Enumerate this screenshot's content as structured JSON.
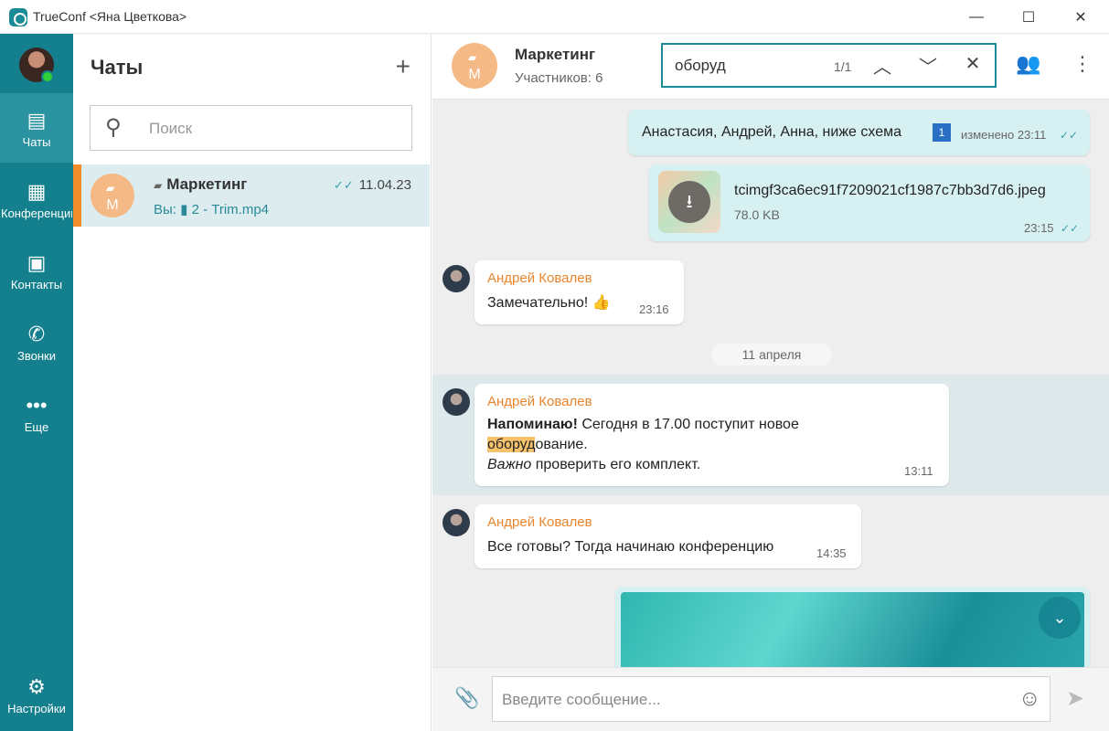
{
  "window": {
    "title": "TrueConf <Яна Цветкова>",
    "minimize": "—",
    "maximize": "☐",
    "close": "✕"
  },
  "rail": {
    "items": [
      {
        "label": "Чаты",
        "icon": "chat-icon",
        "glyph": "▤"
      },
      {
        "label": "Конференции",
        "icon": "conference-icon",
        "glyph": "▦"
      },
      {
        "label": "Контакты",
        "icon": "contacts-icon",
        "glyph": "▣"
      },
      {
        "label": "Звонки",
        "icon": "calls-icon",
        "glyph": "✆"
      },
      {
        "label": "Еще",
        "icon": "more-icon",
        "glyph": "•••"
      }
    ],
    "settings": {
      "label": "Настройки",
      "icon": "gear-icon",
      "glyph": "⚙"
    }
  },
  "chats": {
    "heading": "Чаты",
    "add": "+",
    "search_placeholder": "Поиск",
    "item": {
      "avatar_letter": "М",
      "name": "Маркетинг",
      "date": "11.04.23",
      "sub_prefix": "Вы:",
      "sub_file": "2 - Trim.mp4"
    }
  },
  "conversation": {
    "name": "Маркетинг",
    "members": "Участников: 6",
    "avatar_letter": "М",
    "search": {
      "query": "оборуд",
      "count": "1/1"
    },
    "messages": {
      "m1": {
        "text": "Анастасия, Андрей, Анна, ниже схема",
        "edited": "изменено 23:11"
      },
      "m2": {
        "file": "tcimgf3ca6ec91f7209021cf1987c7bb3d7d6.jpeg",
        "size": "78.0 KB",
        "time": "23:15"
      },
      "m3": {
        "sender": "Андрей Ковалев",
        "text": "Замечательно! 👍",
        "time": "23:16"
      },
      "day": "11 апреля",
      "m4": {
        "sender": "Андрей Ковалев",
        "bold": "Напоминаю!",
        "text1": " Сегодня в 17.00 поступит новое",
        "hl": "оборуд",
        "text2": "ование.",
        "italic": "Важно",
        "text3": " проверить его комплект.",
        "time": "13:11"
      },
      "m5": {
        "sender": "Андрей Ковалев",
        "text": "Все готовы? Тогда начинаю конференцию",
        "time": "14:35"
      }
    },
    "composer_placeholder": "Введите сообщение..."
  },
  "colors": {
    "accent": "#147f8d",
    "orange": "#f08c2a",
    "outgoing": "#d7f1f3"
  }
}
